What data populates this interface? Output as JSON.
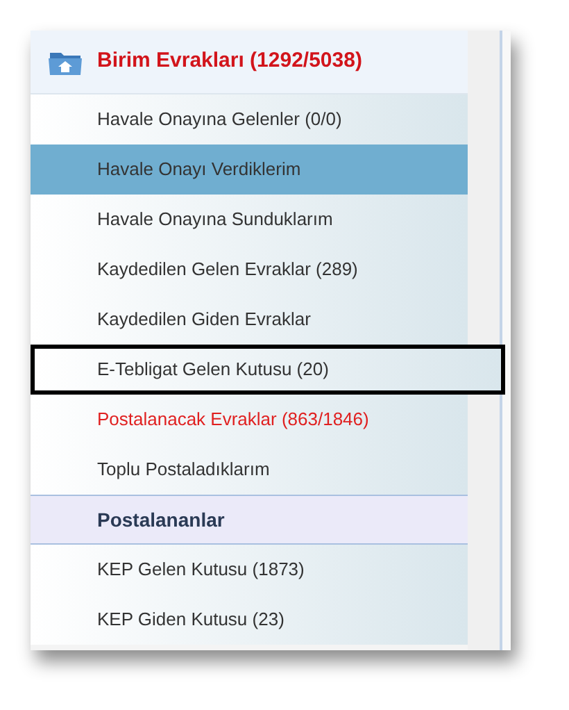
{
  "menu": {
    "header": {
      "title": "Birim Evrakları (1292/5038)"
    },
    "items": [
      {
        "kind": "link",
        "label": "Havale Onayına Gelenler (0/0)",
        "selected": false,
        "alert": false,
        "outlined": false
      },
      {
        "kind": "link",
        "label": "Havale Onayı Verdiklerim",
        "selected": true,
        "alert": false,
        "outlined": false
      },
      {
        "kind": "link",
        "label": "Havale Onayına Sunduklarım",
        "selected": false,
        "alert": false,
        "outlined": false
      },
      {
        "kind": "link",
        "label": "Kaydedilen Gelen Evraklar (289)",
        "selected": false,
        "alert": false,
        "outlined": false
      },
      {
        "kind": "link",
        "label": "Kaydedilen Giden Evraklar",
        "selected": false,
        "alert": false,
        "outlined": false
      },
      {
        "kind": "link",
        "label": "E-Tebligat Gelen Kutusu (20)",
        "selected": false,
        "alert": false,
        "outlined": true
      },
      {
        "kind": "link",
        "label": "Postalanacak Evraklar (863/1846)",
        "selected": false,
        "alert": true,
        "outlined": false
      },
      {
        "kind": "link",
        "label": "Toplu Postaladıklarım",
        "selected": false,
        "alert": false,
        "outlined": false
      },
      {
        "kind": "section",
        "label": "Postalananlar",
        "selected": false,
        "alert": false,
        "outlined": false
      },
      {
        "kind": "link",
        "label": "KEP Gelen Kutusu (1873)",
        "selected": false,
        "alert": false,
        "outlined": false
      },
      {
        "kind": "link",
        "label": "KEP Giden Kutusu (23)",
        "selected": false,
        "alert": false,
        "outlined": false
      }
    ]
  }
}
